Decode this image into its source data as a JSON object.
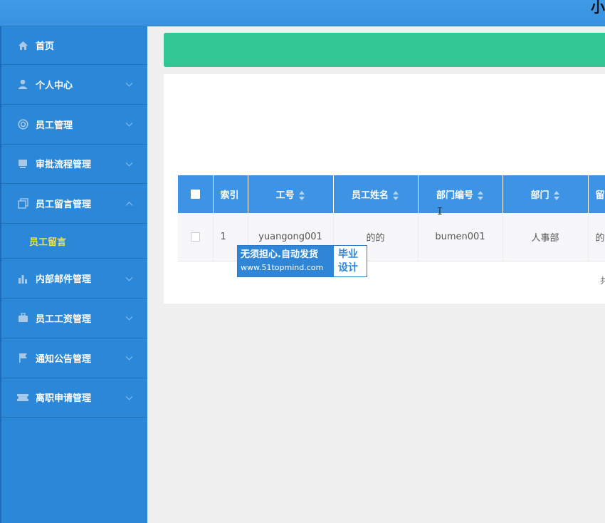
{
  "header": {
    "title": "小"
  },
  "sidebar": {
    "items": [
      {
        "label": "首页",
        "icon": "home-icon"
      },
      {
        "label": "个人中心",
        "icon": "user-icon"
      },
      {
        "label": "员工管理",
        "icon": "lifebuoy-icon"
      },
      {
        "label": "审批流程管理",
        "icon": "monitor-icon"
      },
      {
        "label": "员工留言管理",
        "icon": "copy-icon",
        "expanded": true,
        "children": [
          {
            "label": "员工留言",
            "active": true
          }
        ]
      },
      {
        "label": "内部邮件管理",
        "icon": "bar-chart-icon"
      },
      {
        "label": "员工工资管理",
        "icon": "briefcase-icon"
      },
      {
        "label": "通知公告管理",
        "icon": "flag-icon"
      },
      {
        "label": "离职申请管理",
        "icon": "ticket-icon"
      }
    ]
  },
  "table": {
    "headers": [
      "索引",
      "工号",
      "员工姓名",
      "部门编号",
      "部门",
      "留"
    ],
    "rows": [
      {
        "index": "1",
        "emp_no": "yuangong001",
        "name": "的的",
        "dept_no": "bumen001",
        "dept": "人事部",
        "message": "的"
      }
    ]
  },
  "pager": {
    "fragment": "共"
  },
  "watermark": {
    "line1": "无须担心.自动发货",
    "line2": "www.51topmind.com",
    "side1": "毕业",
    "side2": "设计"
  },
  "colors": {
    "sidebar": "#2b87d8",
    "topbar": "#3f9ae8",
    "greenbar": "#32c694",
    "table_header": "#3d93e4",
    "active_submenu": "#f2e33a"
  }
}
